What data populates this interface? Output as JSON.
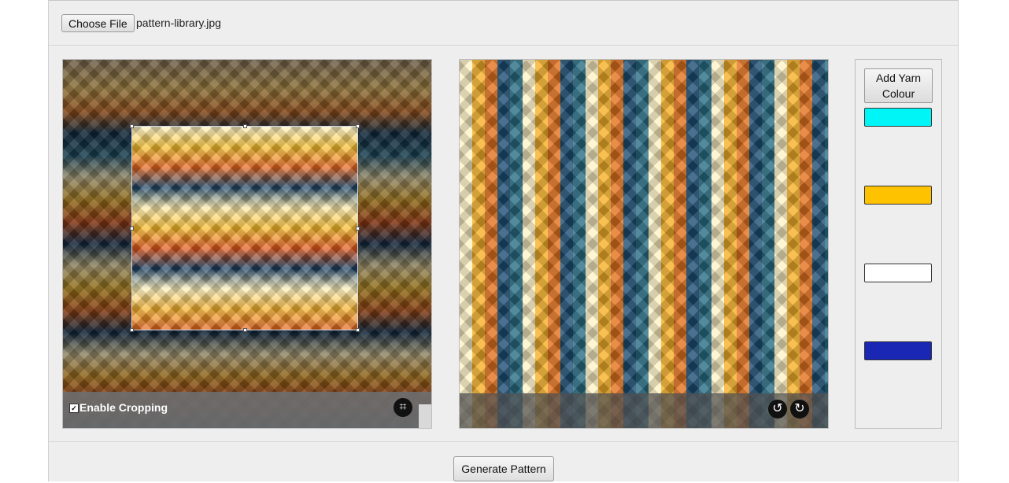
{
  "file_input": {
    "button_label": "Choose File",
    "file_name": "pattern-library.jpg"
  },
  "source_panel": {
    "enable_cropping_label": "Enable Cropping",
    "enable_cropping_checked": true,
    "crop_icon": "crop-icon"
  },
  "preview_panel": {
    "rotate_left_icon": "rotate-left-icon",
    "rotate_right_icon": "rotate-right-icon"
  },
  "yarn": {
    "add_label": "Add Yarn Colour",
    "colours": [
      "#00f6f6",
      "#ffc200",
      "#ffffff",
      "#1a27b4"
    ]
  },
  "footer": {
    "generate_label": "Generate Pattern"
  }
}
